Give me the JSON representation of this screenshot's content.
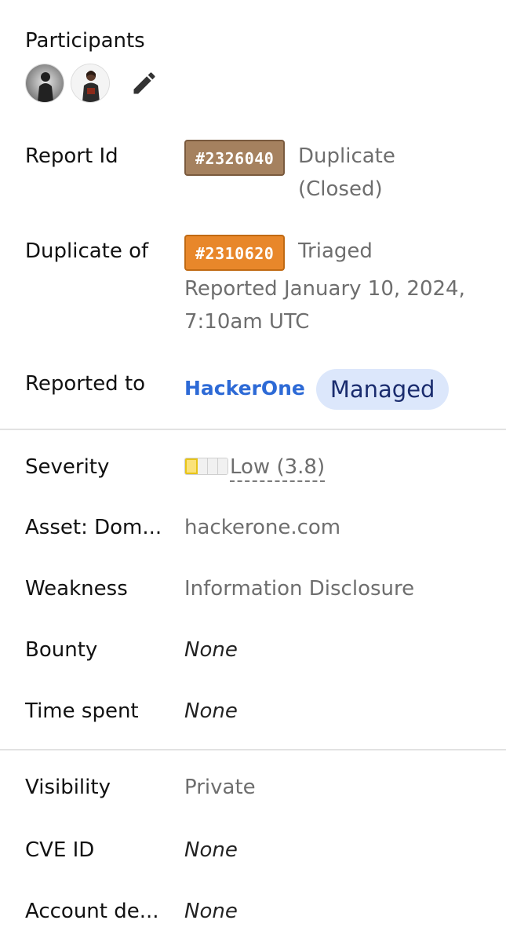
{
  "participants": {
    "title": "Participants",
    "avatars": [
      "avatar-1",
      "avatar-2"
    ],
    "edit_icon": "pencil-icon"
  },
  "report_id": {
    "label": "Report Id",
    "badge": "#2326040",
    "status_line1": "Duplicate",
    "status_line2": "(Closed)",
    "badge_color": "#a5815f"
  },
  "duplicate_of": {
    "label": "Duplicate of",
    "badge": "#2310620",
    "status": "Triaged",
    "reported_line1": "Reported January 10, 2024,",
    "reported_line2": "7:10am UTC",
    "badge_color": "#e8872a"
  },
  "reported_to": {
    "label": "Reported to",
    "program": "HackerOne",
    "tag": "Managed",
    "link_color": "#2d6ad6"
  },
  "details": {
    "severity_label": "Severity",
    "severity_value": "Low (3.8)",
    "severity_level": 1,
    "severity_segments": 4,
    "asset_label": "Asset: Dom...",
    "asset_value": "hackerone.com",
    "weakness_label": "Weakness",
    "weakness_value": "Information Disclosure",
    "bounty_label": "Bounty",
    "bounty_value": "None",
    "time_label": "Time spent",
    "time_value": "None"
  },
  "meta": {
    "visibility_label": "Visibility",
    "visibility_value": "Private",
    "cve_label": "CVE ID",
    "cve_value": "None",
    "account_label": "Account de...",
    "account_value": "None"
  }
}
